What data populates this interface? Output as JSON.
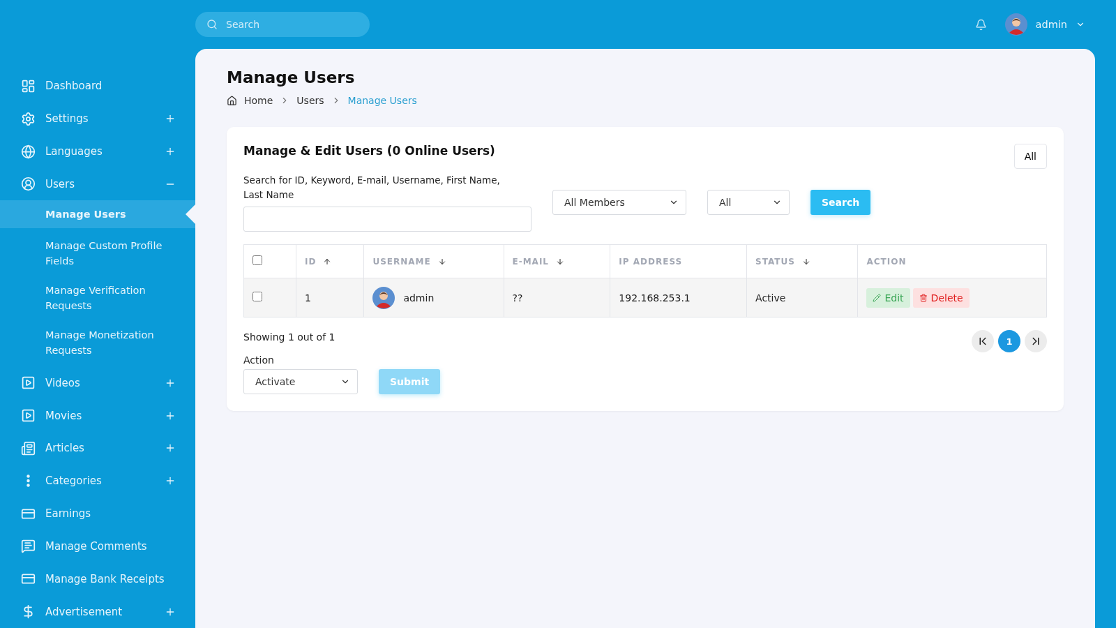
{
  "topbar": {
    "search": {
      "placeholder": "Search"
    },
    "user": {
      "name": "admin"
    }
  },
  "sidebar": {
    "items": [
      {
        "label": "Dashboard"
      },
      {
        "label": "Settings",
        "expanded": false
      },
      {
        "label": "Languages",
        "expanded": false
      },
      {
        "label": "Users",
        "expanded": true,
        "children": [
          {
            "label": "Manage Users",
            "selected": true
          },
          {
            "label": "Manage Custom Profile Fields",
            "selected": false
          },
          {
            "label": "Manage Verification Requests",
            "selected": false
          },
          {
            "label": "Manage Monetization Requests",
            "selected": false
          }
        ]
      },
      {
        "label": "Videos",
        "expanded": false
      },
      {
        "label": "Movies",
        "expanded": false
      },
      {
        "label": "Articles",
        "expanded": false
      },
      {
        "label": "Categories",
        "expanded": false
      },
      {
        "label": "Earnings"
      },
      {
        "label": "Manage Comments"
      },
      {
        "label": "Manage Bank Receipts"
      },
      {
        "label": "Advertisement",
        "expanded": false
      }
    ]
  },
  "page": {
    "title": "Manage Users",
    "breadcrumb": [
      {
        "label": "Home",
        "current": false
      },
      {
        "label": "Users",
        "current": false
      },
      {
        "label": "Manage Users",
        "current": true
      }
    ]
  },
  "card": {
    "title": "Manage & Edit Users (0 Online Users)",
    "filter_button": "All",
    "search_label": "Search for ID, Keyword, E-mail, Username, First Name, Last Name",
    "member_select": "All Members",
    "status_select": "All",
    "search_button": "Search",
    "table": {
      "columns": [
        {
          "label": "ID",
          "ascending": true
        },
        {
          "label": "USERNAME",
          "ascending": false
        },
        {
          "label": "E-MAIL",
          "ascending": false
        },
        {
          "label": "IP ADDRESS"
        },
        {
          "label": "STATUS",
          "ascending": false
        },
        {
          "label": "ACTION"
        }
      ],
      "rows": [
        {
          "checked": false,
          "id": "1",
          "username": "admin",
          "email": "??",
          "ip": "192.168.253.1",
          "status": "Active",
          "edit": "Edit",
          "delete": "Delete"
        }
      ]
    },
    "header_checked": false,
    "showing": "Showing 1 out of 1",
    "pagination": [
      {
        "label": "1",
        "selected": true
      }
    ],
    "action_label": "Action",
    "action_select": "Activate",
    "submit": "Submit"
  }
}
